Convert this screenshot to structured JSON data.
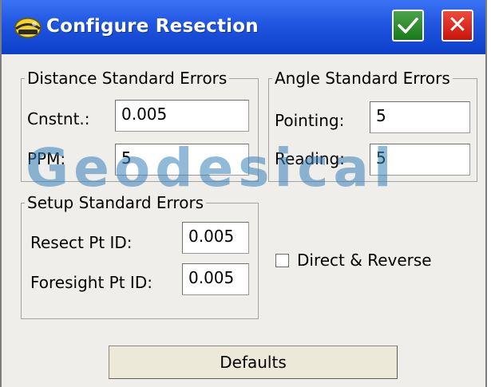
{
  "window": {
    "title": "Configure Resection",
    "colors": {
      "titlebar": "#1f55e0",
      "ok": "#197a17",
      "close": "#c9140b",
      "dialog_bg": "#efeeea"
    },
    "icons": {
      "app": "surveyor-helmet-icon",
      "ok": "checkmark-icon",
      "close": "close-x-icon"
    },
    "close_glyph": "✕"
  },
  "distance_group": {
    "legend": "Distance Standard Errors",
    "cnstnt_label": "Cnstnt.:",
    "cnstnt_value": "0.005",
    "ppm_label": "PPM:",
    "ppm_value": "5"
  },
  "angle_group": {
    "legend": "Angle Standard Errors",
    "pointing_label": "Pointing:",
    "pointing_value": "5",
    "reading_label": "Reading:",
    "reading_value": "5"
  },
  "setup_group": {
    "legend": "Setup Standard Errors",
    "resect_label": "Resect Pt ID:",
    "resect_value": "0.005",
    "foresight_label": "Foresight Pt ID:",
    "foresight_value": "0.005"
  },
  "direct_reverse": {
    "label": "Direct & Reverse",
    "checked": false
  },
  "defaults_button": {
    "label": "Defaults"
  },
  "watermark": {
    "text": "Geodesical"
  }
}
